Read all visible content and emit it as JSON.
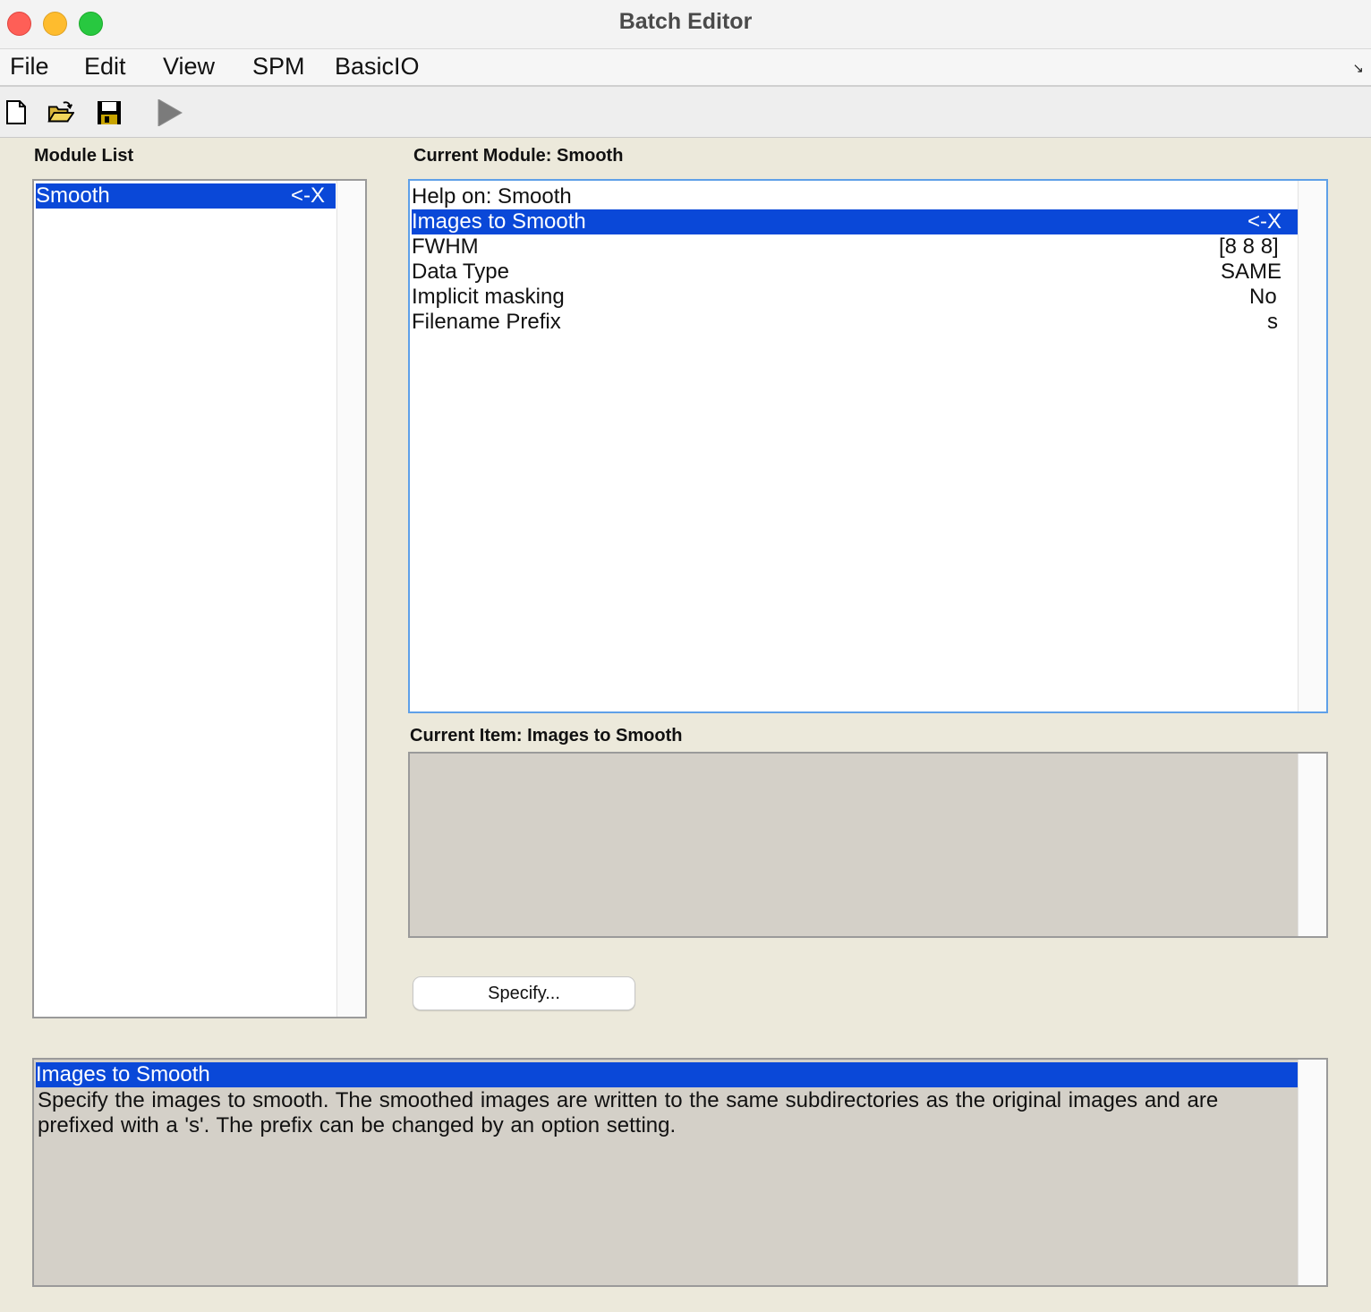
{
  "window": {
    "title": "Batch Editor"
  },
  "menu": [
    "File",
    "Edit",
    "View",
    "SPM",
    "BasicIO"
  ],
  "toolbar": {
    "icons": [
      "new-file-icon",
      "open-folder-icon",
      "save-icon",
      "run-icon"
    ]
  },
  "module_list": {
    "label": "Module List",
    "items": [
      {
        "name": "Smooth",
        "tag": "<-X"
      }
    ]
  },
  "current_module": {
    "label": "Current Module: Smooth",
    "items": [
      {
        "name": "Help on: Smooth",
        "value": ""
      },
      {
        "name": "Images to Smooth",
        "value": "<-X"
      },
      {
        "name": "FWHM",
        "value": "[8 8 8]"
      },
      {
        "name": "Data Type",
        "value": "SAME"
      },
      {
        "name": "Implicit masking",
        "value": "No"
      },
      {
        "name": "Filename Prefix",
        "value": "s"
      }
    ]
  },
  "current_item": {
    "label": "Current Item: Images to Smooth"
  },
  "specify_button": "Specify...",
  "help": {
    "title": "Images to Smooth",
    "text": "Specify  the  images  to smooth. The smoothed images are written to the same subdirectories as the original images and are prefixed with a 's'. The prefix can be changed by an option setting."
  },
  "colors": {
    "selection": "#0a48d8",
    "background": "#ece9db",
    "panel_gray": "#d4d0c8"
  }
}
